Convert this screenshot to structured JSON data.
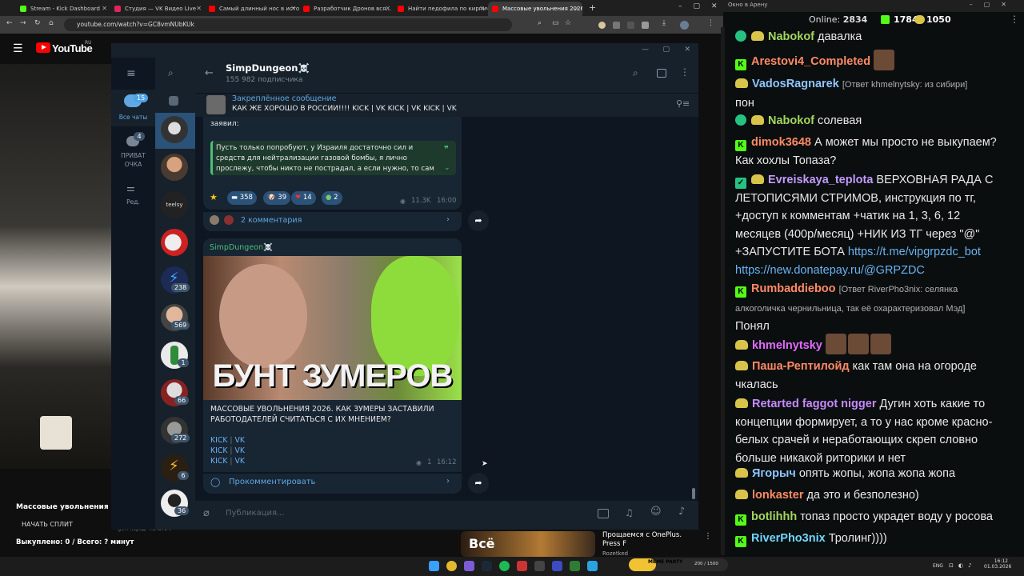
{
  "browser": {
    "tabs": [
      {
        "label": "Stream - Kick Dashboard",
        "color": "#53fc18",
        "active": false
      },
      {
        "label": "Студия — VK Видео Live",
        "color": "#e0245e",
        "active": false
      },
      {
        "label": "Самый длинный нос в истор...",
        "color": "#ff0000",
        "active": false
      },
      {
        "label": "Разработчик Дронов вся...",
        "color": "#ff0000",
        "active": false
      },
      {
        "label": "Найти педофила по кирпичу...",
        "color": "#ff0000",
        "active": false
      },
      {
        "label": "Массовые увольнения 2026. В...",
        "color": "#ff0000",
        "active": true
      }
    ],
    "url": "youtube.com/watch?v=GC8vmNUbKUk"
  },
  "youtube": {
    "logo_text": "YouTube",
    "region": "RU",
    "video_title": "Массовые увольнения 2026.",
    "start_split": "НАЧАТЬ СПЛИТ",
    "split_hint": "(уст. перед \"Начать\")",
    "bought": "Выкуплено: 0 / Всего: ? минут",
    "rec_title": "Прощаемся с OnePlus. Press F",
    "rec_channel": "Rozetked",
    "rec_thumb_text": "Всё"
  },
  "telegram": {
    "rail": {
      "all_chats": "Все чаты",
      "all_chats_badge": "15",
      "private": "ПРИВАТ ОЧКА",
      "private_badge": "4",
      "edit": "Ред."
    },
    "chat_badges": [
      "238",
      "569",
      "1",
      "66",
      "272",
      "6",
      "36"
    ],
    "channel": {
      "name": "SimpDungeon☠️",
      "subscribers": "155 982 подписчика"
    },
    "pinned": {
      "label": "Закреплённое сообщение",
      "text": "КАК ЖЕ ХОРОШО В РОССИИ!!!!  KICK | VK KICK | VK KICK | VK"
    },
    "post1": {
      "intro": "заявил:",
      "quote": "Пусть только попробуют, у Израиля достаточно сил и средств для нейтрализации газовой бомбы, я лично прослежу, чтобы никто не пострадал, а если нужно, то сам",
      "reactions": [
        "358",
        "39",
        "14",
        "2"
      ],
      "views": "11.3K",
      "time": "16:00",
      "comments": "2 комментария"
    },
    "post2": {
      "author": "SimpDungeon☠️",
      "image_text": "БУНТ ЗУМЕРОВ",
      "text": "МАССОВЫЕ УВОЛЬНЕНИЯ 2026. КАК ЗУМЕРЫ ЗАСТАВИЛИ РАБОТОДАТЕЛЕЙ СЧИТАТЬСЯ С ИХ МНЕНИЕМ?",
      "links": [
        "KICK",
        "VK",
        "KICK",
        "VK",
        "KICK",
        "VK"
      ],
      "views": "1",
      "time": "16:12",
      "comment_cta": "Прокомментировать"
    },
    "composer_placeholder": "Публикация..."
  },
  "kick_chat": {
    "window_title": "Окно в Арену",
    "online_label": "Online:",
    "online": "2834",
    "count_kick": "1784",
    "count_other": "1050",
    "messages": [
      {
        "user": "Nabokof",
        "color": "#a4d65e",
        "text": "давалка"
      },
      {
        "user": "Arestovi4_Completed",
        "color": "#ff8a65",
        "text": ""
      },
      {
        "user": "VadosRagnarek",
        "color": "#8ec5ff",
        "reply": "[Ответ khmelnytsky: из сибири]",
        "text": "пон"
      },
      {
        "user": "Nabokof",
        "color": "#a4d65e",
        "text": "солевая"
      },
      {
        "user": "dimok3648",
        "color": "#ff8a65",
        "text": "А может мы просто не выкупаем? Как хохлы Топаза?"
      },
      {
        "user": "Evreiskaya_teplota",
        "color": "#c39bff",
        "text": "ВЕРХОВНАЯ РАДА С ЛЕТОПИСЯМИ СТРИМОВ, инструкция по тг, +доступ к комментам +чатик  на 1, 3, 6, 12 месяцев (400р/месяц) +НИК ИЗ ТГ через \"@\" +ЗАПУСТИТЕ БОТА",
        "link1": "https://t.me/vipgrpzdc_bot",
        "link2": "https://new.donatepay.ru/@GRPZDC"
      },
      {
        "user": "Rumbaddieboo",
        "color": "#ff8a65",
        "reply": "[Ответ RiverPho3nix: селянка алкоголичка чернильница, так её охарактеризовал Мэд]",
        "text": "Понял"
      },
      {
        "user": "khmelnytsky",
        "color": "#e36bff",
        "text": ""
      },
      {
        "user": "Паша-Рептилойд",
        "color": "#ff8a65",
        "text": "как там она на огороде чкалась"
      },
      {
        "user": "Retarted faggot nigger",
        "color": "#c58bff",
        "text": "Дугин хоть какие то концепции формирует, а то у нас кроме красно-белых срачей и неработающих скреп словно больше никакой риторики и нет"
      },
      {
        "user": "Ягорыч",
        "color": "#8ec5ff",
        "text": "опять жопы, жопа жопа жопа"
      },
      {
        "user": "lonkaster",
        "color": "#ff8a65",
        "text": "да это и безполезно)"
      },
      {
        "user": "botlihhh",
        "color": "#a4d65e",
        "text": "топаз просто украдет воду у росова"
      },
      {
        "user": "RiverPho3nix",
        "color": "#6fd7ff",
        "text": "Тролинг))))"
      }
    ]
  },
  "taskbar": {
    "media_label": "MEME PARTY",
    "media_progress": "200 / 1500",
    "lang": "ENG",
    "time": "16:12",
    "date": "01.03.2026"
  }
}
